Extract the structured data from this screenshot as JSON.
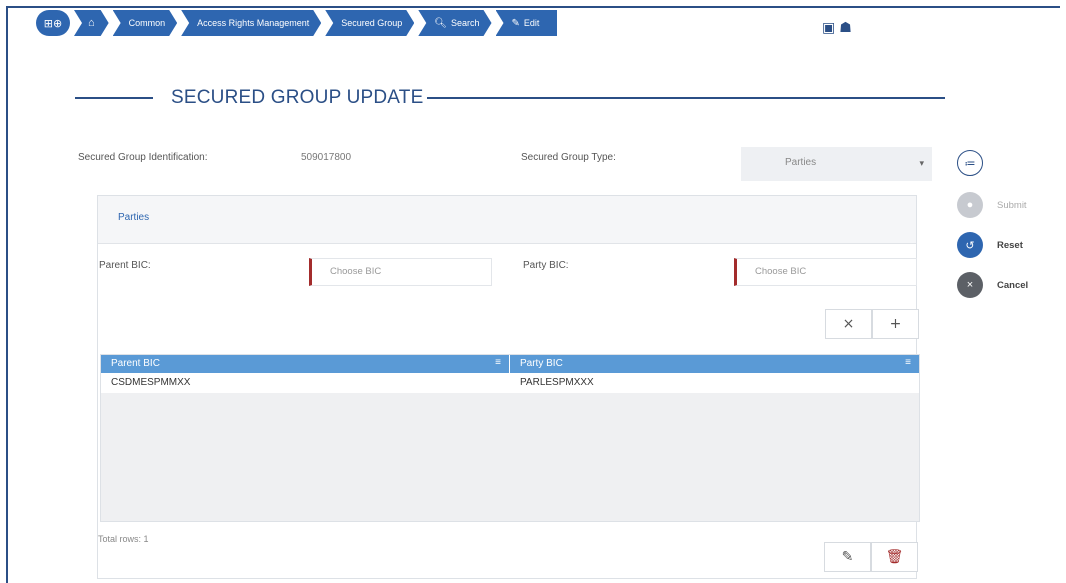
{
  "breadcrumb": {
    "pill": "⊞⊕",
    "items": [
      "Common",
      "Access Rights Management",
      "Secured Group",
      "Search",
      "Edit"
    ]
  },
  "title": "SECURED GROUP UPDATE",
  "form": {
    "id_label": "Secured Group Identification:",
    "id_value": "509017800",
    "type_label": "Secured Group Type:",
    "type_value": "Parties"
  },
  "section": {
    "tab_label": "Parties",
    "parent_bic_label": "Parent BIC:",
    "parent_bic_placeholder": "Choose BIC",
    "party_bic_label": "Party BIC:",
    "party_bic_placeholder": "Choose BIC"
  },
  "grid": {
    "columns": [
      "Parent BIC",
      "Party BIC"
    ],
    "rows": [
      [
        "CSDMESPMMXX",
        "PARLESPMXXX"
      ]
    ],
    "total_label": "Total rows: 1"
  },
  "actions": {
    "submit": "Submit",
    "reset": "Reset",
    "cancel": "Cancel"
  },
  "colors": {
    "primary": "#2b4f86",
    "accent_blue": "#2e66b0",
    "header_blue": "#5a9ad6",
    "danger": "#a32c2c"
  }
}
